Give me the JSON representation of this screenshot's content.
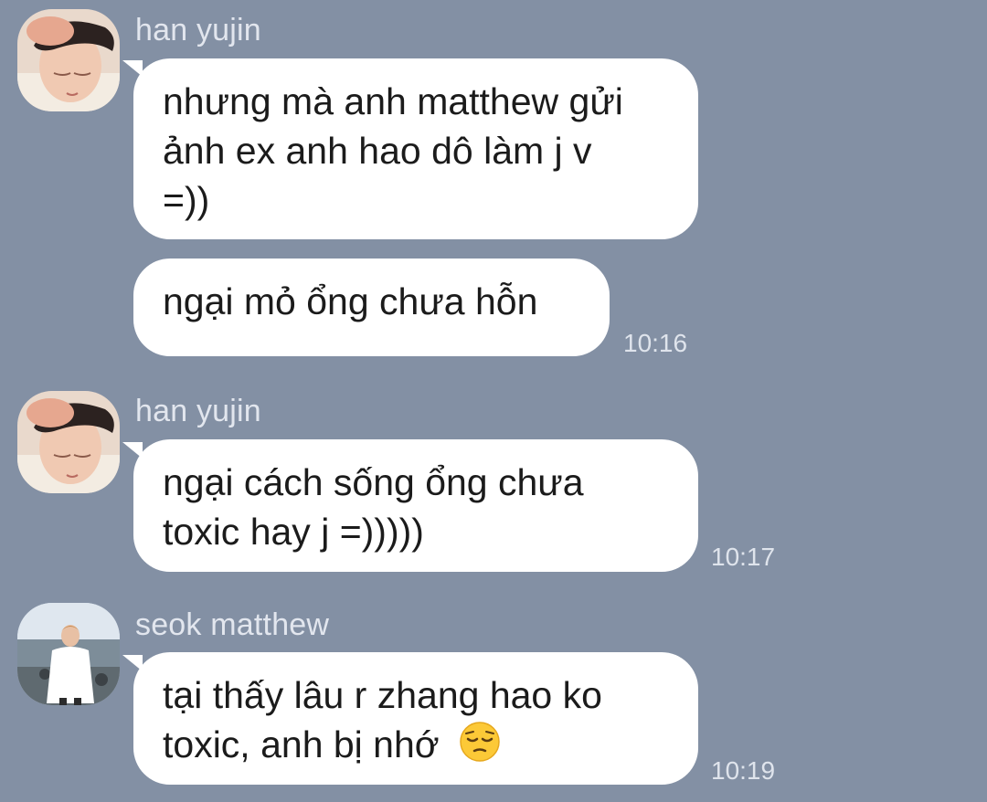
{
  "messages": [
    {
      "sender": "han yujin",
      "bubbles": [
        {
          "lines": [
            "nhưng mà anh matthew gửi",
            "ảnh ex anh hao dô làm j v",
            "=))"
          ]
        },
        {
          "lines": [
            "ngại mỏ ổng chưa hỗn"
          ],
          "time": "10:16"
        }
      ]
    },
    {
      "sender": "han yujin",
      "bubbles": [
        {
          "lines": [
            "ngại cách sống ổng chưa",
            "toxic hay j =)))))"
          ],
          "time": "10:17"
        }
      ]
    },
    {
      "sender": "seok matthew",
      "bubbles": [
        {
          "lines": [
            "tại thấy lâu r zhang hao ko",
            "toxic, anh bị nhớ"
          ],
          "time": "10:19",
          "emoji": "pensive-face"
        }
      ]
    }
  ],
  "colors": {
    "background": "#8390a4",
    "bubble": "#ffffff",
    "text": "#1b1b1b",
    "meta_text": "#e2e6ee"
  }
}
